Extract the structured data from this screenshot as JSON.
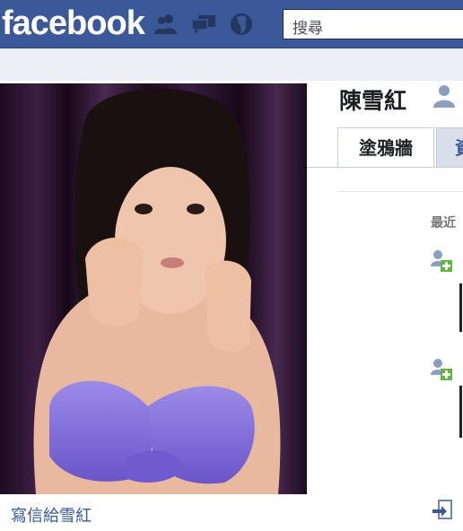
{
  "header": {
    "logo_text": "facebook",
    "search_placeholder": "搜尋",
    "jewels": [
      "friend-requests-icon",
      "messages-icon",
      "notifications-globe-icon"
    ]
  },
  "profile": {
    "name": "陳雪紅",
    "message_link": "寫信給雪紅"
  },
  "tabs": [
    {
      "label": "塗鴉牆"
    },
    {
      "label": "資"
    }
  ],
  "feed": {
    "section_label": "最近"
  },
  "colors": {
    "brand_blue": "#3b5998",
    "tab_inactive": "#d8dfea",
    "page_band": "#eceff5"
  }
}
